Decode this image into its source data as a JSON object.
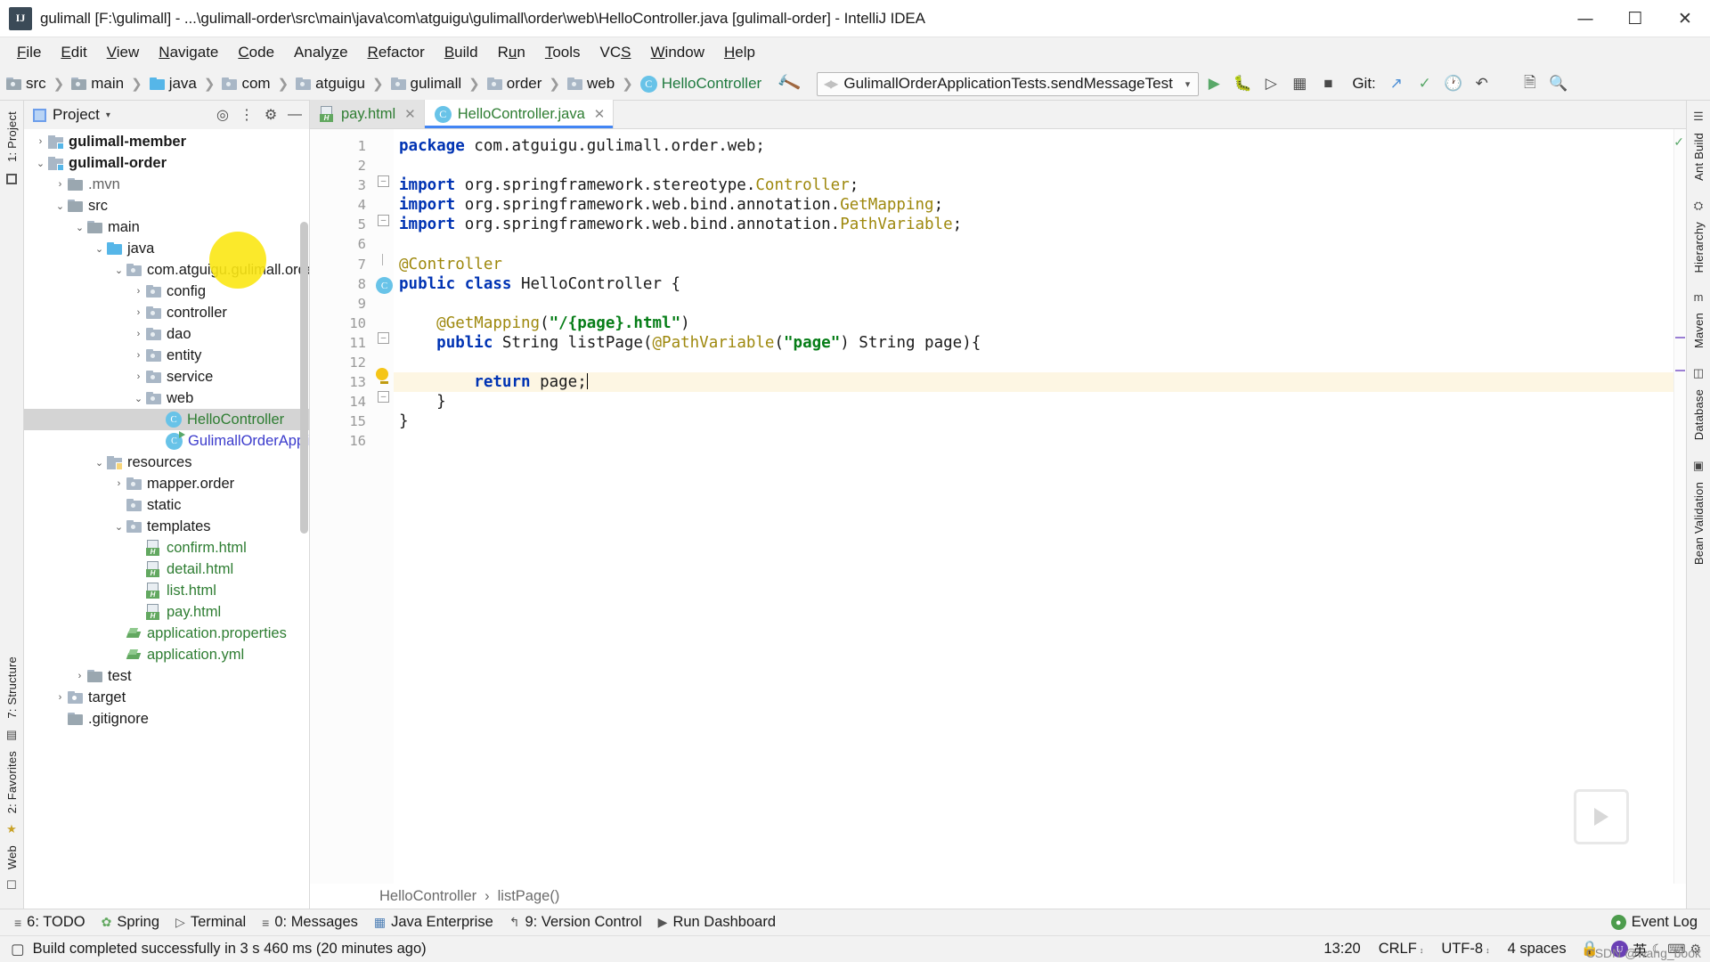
{
  "window": {
    "title": "gulimall [F:\\gulimall] - ...\\gulimall-order\\src\\main\\java\\com\\atguigu\\gulimall\\order\\web\\HelloController.java [gulimall-order] - IntelliJ IDEA",
    "app_icon": "intellij-idea-icon",
    "minimize": "—",
    "maximize": "☐",
    "close": "✕"
  },
  "menubar": {
    "items": [
      "File",
      "Edit",
      "View",
      "Navigate",
      "Code",
      "Analyze",
      "Refactor",
      "Build",
      "Run",
      "Tools",
      "VCS",
      "Window",
      "Help"
    ]
  },
  "navbar": {
    "breadcrumbs": [
      {
        "label": "src",
        "icon": "folder-icon"
      },
      {
        "label": "main",
        "icon": "folder-icon"
      },
      {
        "label": "java",
        "icon": "folder-blue-icon"
      },
      {
        "label": "com",
        "icon": "package-icon"
      },
      {
        "label": "atguigu",
        "icon": "package-icon"
      },
      {
        "label": "gulimall",
        "icon": "package-icon"
      },
      {
        "label": "order",
        "icon": "package-icon"
      },
      {
        "label": "web",
        "icon": "package-icon"
      },
      {
        "label": "HelloController",
        "icon": "class-icon"
      }
    ],
    "build_icon": "hammer-icon",
    "run_config": "GulimallOrderApplicationTests.sendMessageTest",
    "run_config_chevron": "▾",
    "toolbar_icons": [
      "run-icon",
      "debug-icon",
      "run-coverage-icon",
      "profiler-icon",
      "stop-icon"
    ],
    "git_label": "Git:",
    "git_icons": [
      "update-project-icon",
      "commit-icon",
      "history-icon",
      "rollback-icon"
    ],
    "right_icons": [
      "search-everywhere-icon",
      "settings-icon"
    ]
  },
  "left_rail": {
    "items": [
      {
        "label": "1: Project",
        "icon": "project-icon"
      },
      {
        "label": "7: Structure",
        "icon": "structure-icon"
      },
      {
        "label": "2: Favorites",
        "icon": "favorites-icon"
      },
      {
        "label": "Web",
        "icon": "web-icon"
      }
    ]
  },
  "right_rail": {
    "items": [
      "Ant Build",
      "Hierarchy",
      "Maven",
      "Database",
      "Bean Validation"
    ]
  },
  "project_panel": {
    "title": "Project",
    "chevron": "▾",
    "tools": [
      "target-icon",
      "collapse-all-icon",
      "settings-icon",
      "hide-icon"
    ],
    "tree": [
      {
        "indent": 1,
        "twisty": "›",
        "icon": "module-icon",
        "label": "gulimall-member",
        "style": "bold"
      },
      {
        "indent": 1,
        "twisty": "⌄",
        "icon": "module-icon",
        "label": "gulimall-order",
        "style": "bold"
      },
      {
        "indent": 2,
        "twisty": "›",
        "icon": "folder-icon",
        "label": ".mvn",
        "style": "gray"
      },
      {
        "indent": 2,
        "twisty": "⌄",
        "icon": "folder-icon",
        "label": "src",
        "style": "plain"
      },
      {
        "indent": 3,
        "twisty": "⌄",
        "icon": "folder-icon",
        "label": "main",
        "style": "plain"
      },
      {
        "indent": 4,
        "twisty": "⌄",
        "icon": "folder-blue-icon",
        "label": "java",
        "style": "plain"
      },
      {
        "indent": 5,
        "twisty": "⌄",
        "icon": "package-icon",
        "label": "com.atguigu.gulimall.order",
        "style": "plain"
      },
      {
        "indent": 6,
        "twisty": "›",
        "icon": "package-icon",
        "label": "config",
        "style": "plain"
      },
      {
        "indent": 6,
        "twisty": "›",
        "icon": "package-icon",
        "label": "controller",
        "style": "plain"
      },
      {
        "indent": 6,
        "twisty": "›",
        "icon": "package-icon",
        "label": "dao",
        "style": "plain"
      },
      {
        "indent": 6,
        "twisty": "›",
        "icon": "package-icon",
        "label": "entity",
        "style": "plain"
      },
      {
        "indent": 6,
        "twisty": "›",
        "icon": "package-icon",
        "label": "service",
        "style": "plain"
      },
      {
        "indent": 6,
        "twisty": "⌄",
        "icon": "package-icon",
        "label": "web",
        "style": "plain"
      },
      {
        "indent": 7,
        "twisty": "",
        "icon": "java-class-icon",
        "label": "HelloController",
        "style": "green",
        "selected": true
      },
      {
        "indent": 7,
        "twisty": "",
        "icon": "spring-class-icon",
        "label": "GulimallOrderApplica",
        "style": "blue"
      },
      {
        "indent": 4,
        "twisty": "⌄",
        "icon": "resources-icon",
        "label": "resources",
        "style": "plain"
      },
      {
        "indent": 5,
        "twisty": "›",
        "icon": "package-icon",
        "label": "mapper.order",
        "style": "plain"
      },
      {
        "indent": 5,
        "twisty": "",
        "icon": "package-icon",
        "label": "static",
        "style": "plain"
      },
      {
        "indent": 5,
        "twisty": "⌄",
        "icon": "package-icon",
        "label": "templates",
        "style": "plain"
      },
      {
        "indent": 6,
        "twisty": "",
        "icon": "html-file-icon",
        "label": "confirm.html",
        "style": "green"
      },
      {
        "indent": 6,
        "twisty": "",
        "icon": "html-file-icon",
        "label": "detail.html",
        "style": "green"
      },
      {
        "indent": 6,
        "twisty": "",
        "icon": "html-file-icon",
        "label": "list.html",
        "style": "green"
      },
      {
        "indent": 6,
        "twisty": "",
        "icon": "html-file-icon",
        "label": "pay.html",
        "style": "green"
      },
      {
        "indent": 5,
        "twisty": "",
        "icon": "properties-file-icon",
        "label": "application.properties",
        "style": "green"
      },
      {
        "indent": 5,
        "twisty": "",
        "icon": "yaml-file-icon",
        "label": "application.yml",
        "style": "green"
      },
      {
        "indent": 3,
        "twisty": "›",
        "icon": "folder-icon",
        "label": "test",
        "style": "plain"
      },
      {
        "indent": 2,
        "twisty": "›",
        "icon": "folder-orange-icon",
        "label": "target",
        "style": "plain"
      },
      {
        "indent": 2,
        "twisty": "",
        "icon": "file-icon",
        "label": ".gitignore",
        "style": "plain"
      }
    ]
  },
  "editor": {
    "tabs": [
      {
        "label": "pay.html",
        "icon": "html-file-icon",
        "active": false,
        "close": "✕"
      },
      {
        "label": "HelloController.java",
        "icon": "java-class-icon",
        "active": true,
        "close": "✕"
      }
    ],
    "line_numbers": [
      "1",
      "2",
      "3",
      "4",
      "5",
      "6",
      "7",
      "8",
      "9",
      "10",
      "11",
      "12",
      "13",
      "14",
      "15",
      "16"
    ],
    "code_lines": [
      {
        "n": 1,
        "segments": [
          {
            "t": "package ",
            "c": "kw"
          },
          {
            "t": "com.atguigu.gulimall.order.web;",
            "c": "pln"
          }
        ]
      },
      {
        "n": 2,
        "segments": []
      },
      {
        "n": 3,
        "segments": [
          {
            "t": "import ",
            "c": "kw"
          },
          {
            "t": "org.springframework.stereotype.",
            "c": "pln"
          },
          {
            "t": "Controller",
            "c": "typ"
          },
          {
            "t": ";",
            "c": "pln"
          }
        ]
      },
      {
        "n": 4,
        "segments": [
          {
            "t": "import ",
            "c": "kw"
          },
          {
            "t": "org.springframework.web.bind.annotation.",
            "c": "pln"
          },
          {
            "t": "GetMapping",
            "c": "typ"
          },
          {
            "t": ";",
            "c": "pln"
          }
        ]
      },
      {
        "n": 5,
        "segments": [
          {
            "t": "import ",
            "c": "kw"
          },
          {
            "t": "org.springframework.web.bind.annotation.",
            "c": "pln"
          },
          {
            "t": "PathVariable",
            "c": "typ"
          },
          {
            "t": ";",
            "c": "pln"
          }
        ]
      },
      {
        "n": 6,
        "segments": []
      },
      {
        "n": 7,
        "segments": [
          {
            "t": "@Controller",
            "c": "ann"
          }
        ]
      },
      {
        "n": 8,
        "segments": [
          {
            "t": "public class ",
            "c": "kw"
          },
          {
            "t": "HelloController {",
            "c": "pln"
          }
        ]
      },
      {
        "n": 9,
        "segments": []
      },
      {
        "n": 10,
        "segments": [
          {
            "t": "    ",
            "c": "pln"
          },
          {
            "t": "@GetMapping",
            "c": "ann"
          },
          {
            "t": "(",
            "c": "pln"
          },
          {
            "t": "\"/{page}.html\"",
            "c": "str"
          },
          {
            "t": ")",
            "c": "pln"
          }
        ]
      },
      {
        "n": 11,
        "segments": [
          {
            "t": "    ",
            "c": "pln"
          },
          {
            "t": "public ",
            "c": "kw"
          },
          {
            "t": "String listPage(",
            "c": "pln"
          },
          {
            "t": "@PathVariable",
            "c": "ann"
          },
          {
            "t": "(",
            "c": "pln"
          },
          {
            "t": "\"page\"",
            "c": "str"
          },
          {
            "t": ") String page){",
            "c": "pln"
          }
        ]
      },
      {
        "n": 12,
        "segments": []
      },
      {
        "n": 13,
        "segments": [
          {
            "t": "        ",
            "c": "pln"
          },
          {
            "t": "return ",
            "c": "kw"
          },
          {
            "t": "page;",
            "c": "pln"
          }
        ],
        "highlight": true
      },
      {
        "n": 14,
        "segments": [
          {
            "t": "    }",
            "c": "pln"
          }
        ]
      },
      {
        "n": 15,
        "segments": [
          {
            "t": "}",
            "c": "pln"
          }
        ]
      },
      {
        "n": 16,
        "segments": []
      }
    ],
    "breadcrumb": [
      "HelloController",
      "listPage()"
    ],
    "breadcrumb_sep": "›",
    "intention_bulb": "lightbulb-icon"
  },
  "bottom_toolwindows": {
    "items": [
      {
        "label": "6: TODO",
        "icon": "todo-icon"
      },
      {
        "label": "Spring",
        "icon": "spring-icon"
      },
      {
        "label": "Terminal",
        "icon": "terminal-icon"
      },
      {
        "label": "0: Messages",
        "icon": "messages-icon"
      },
      {
        "label": "Java Enterprise",
        "icon": "java-enterprise-icon"
      },
      {
        "label": "9: Version Control",
        "icon": "version-control-icon"
      },
      {
        "label": "Run Dashboard",
        "icon": "run-dashboard-icon"
      }
    ],
    "event_log": {
      "label": "Event Log",
      "icon": "event-log-icon"
    }
  },
  "statusbar": {
    "message": "Build completed successfully in 3 s 460 ms (20 minutes ago)",
    "caret_position": "13:20",
    "line_separator": "CRLF",
    "line_separator_chevron": "↕",
    "encoding": "UTF-8",
    "encoding_chevron": "↕",
    "indent": "4 spaces",
    "ime_lang": "英",
    "ime_icons": [
      "u-icon",
      "moon-icon",
      "keyboard-icon",
      "ime-settings-icon"
    ],
    "lock_icon": "lock-icon",
    "watermark": "CSDN @wang_book"
  },
  "colors": {
    "accent_blue": "#4285f4",
    "keyword": "#0033b3",
    "string": "#067d17",
    "annotation": "#9e880d",
    "selection_gray": "#d4d4d4",
    "cursor_highlight": "#fbe714"
  }
}
